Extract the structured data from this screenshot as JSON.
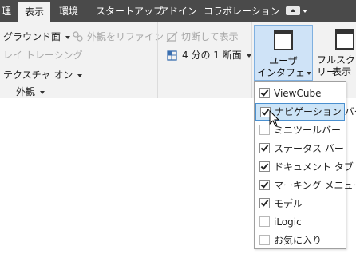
{
  "tabs": [
    {
      "label": "理",
      "active": false
    },
    {
      "label": "表示",
      "active": true
    },
    {
      "label": "環境",
      "active": false
    },
    {
      "label": "スタートアップ",
      "active": false
    },
    {
      "label": "アドイン",
      "active": false
    },
    {
      "label": "コラボレーション",
      "active": false
    }
  ],
  "ribbon": {
    "ground_plane": "グラウンド面",
    "appearance_override": "外観をリファイン",
    "ray_tracing": "レイ トレーシング",
    "texture_on": "テクスチャ オン",
    "panel_appearance": "外観",
    "split_view": "切断して表示",
    "quarter_section": "4 分の 1 断面",
    "user_interface_line1": "ユーザ",
    "user_interface_line2": "インタフェース",
    "fullscreen_line1": "フルスクリー",
    "fullscreen_line2": "表示"
  },
  "menu": {
    "items": [
      {
        "label": "ViewCube",
        "checked": true
      },
      {
        "label": "ナビゲーション バー",
        "checked": true,
        "highlighted": true
      },
      {
        "label": "ミニツールバー",
        "checked": false
      },
      {
        "label": "ステータス バー",
        "checked": true
      },
      {
        "label": "ドキュメント タブ",
        "checked": true
      },
      {
        "label": "マーキング メニュー",
        "checked": true
      },
      {
        "label": "モデル",
        "checked": true
      },
      {
        "label": "iLogic",
        "checked": false
      },
      {
        "label": "お気に入り",
        "checked": false
      }
    ]
  },
  "colors": {
    "tabbar": "#4a4a4a",
    "ribbon": "#f2f2f2",
    "highlight": "#cce4f7",
    "pressed": "#cfe3f7"
  }
}
